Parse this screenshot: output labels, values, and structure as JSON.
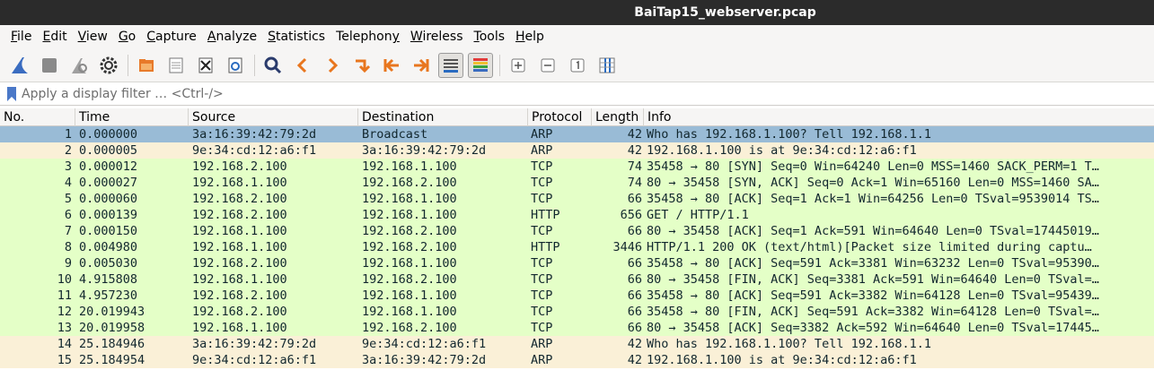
{
  "window": {
    "title": "BaiTap15_webserver.pcap"
  },
  "menu": [
    {
      "pre": "",
      "key": "F",
      "post": "ile"
    },
    {
      "pre": "",
      "key": "E",
      "post": "dit"
    },
    {
      "pre": "",
      "key": "V",
      "post": "iew"
    },
    {
      "pre": "",
      "key": "G",
      "post": "o"
    },
    {
      "pre": "",
      "key": "C",
      "post": "apture"
    },
    {
      "pre": "",
      "key": "A",
      "post": "nalyze"
    },
    {
      "pre": "",
      "key": "S",
      "post": "tatistics"
    },
    {
      "pre": "Telephon",
      "key": "y",
      "post": ""
    },
    {
      "pre": "",
      "key": "W",
      "post": "ireless"
    },
    {
      "pre": "",
      "key": "T",
      "post": "ools"
    },
    {
      "pre": "",
      "key": "H",
      "post": "elp"
    }
  ],
  "filter": {
    "placeholder": "Apply a display filter … <Ctrl-/>"
  },
  "columns": [
    "No.",
    "Time",
    "Source",
    "Destination",
    "Protocol",
    "Length",
    "Info"
  ],
  "colors": {
    "arp": "#faf0d7",
    "tcp": "#e7e6ff",
    "http": "#e4ffc7",
    "selected": "#99bbd6"
  },
  "packets": [
    {
      "no": "1",
      "time": "0.000000",
      "src": "3a:16:39:42:79:2d",
      "dst": "Broadcast",
      "proto": "ARP",
      "len": "42",
      "info": "Who has 192.168.1.100? Tell 192.168.1.1",
      "color": "selected"
    },
    {
      "no": "2",
      "time": "0.000005",
      "src": "9e:34:cd:12:a6:f1",
      "dst": "3a:16:39:42:79:2d",
      "proto": "ARP",
      "len": "42",
      "info": "192.168.1.100 is at 9e:34:cd:12:a6:f1",
      "color": "arp"
    },
    {
      "no": "3",
      "time": "0.000012",
      "src": "192.168.2.100",
      "dst": "192.168.1.100",
      "proto": "TCP",
      "len": "74",
      "info": "35458 → 80 [SYN] Seq=0 Win=64240 Len=0 MSS=1460 SACK_PERM=1 T…",
      "color": "http"
    },
    {
      "no": "4",
      "time": "0.000027",
      "src": "192.168.1.100",
      "dst": "192.168.2.100",
      "proto": "TCP",
      "len": "74",
      "info": "80 → 35458 [SYN, ACK] Seq=0 Ack=1 Win=65160 Len=0 MSS=1460 SA…",
      "color": "http"
    },
    {
      "no": "5",
      "time": "0.000060",
      "src": "192.168.2.100",
      "dst": "192.168.1.100",
      "proto": "TCP",
      "len": "66",
      "info": "35458 → 80 [ACK] Seq=1 Ack=1 Win=64256 Len=0 TSval=9539014 TS…",
      "color": "http"
    },
    {
      "no": "6",
      "time": "0.000139",
      "src": "192.168.2.100",
      "dst": "192.168.1.100",
      "proto": "HTTP",
      "len": "656",
      "info": "GET / HTTP/1.1",
      "color": "http"
    },
    {
      "no": "7",
      "time": "0.000150",
      "src": "192.168.1.100",
      "dst": "192.168.2.100",
      "proto": "TCP",
      "len": "66",
      "info": "80 → 35458 [ACK] Seq=1 Ack=591 Win=64640 Len=0 TSval=17445019…",
      "color": "http"
    },
    {
      "no": "8",
      "time": "0.004980",
      "src": "192.168.1.100",
      "dst": "192.168.2.100",
      "proto": "HTTP",
      "len": "3446",
      "info": "HTTP/1.1 200 OK  (text/html)[Packet size limited during captu…",
      "color": "http"
    },
    {
      "no": "9",
      "time": "0.005030",
      "src": "192.168.2.100",
      "dst": "192.168.1.100",
      "proto": "TCP",
      "len": "66",
      "info": "35458 → 80 [ACK] Seq=591 Ack=3381 Win=63232 Len=0 TSval=95390…",
      "color": "http"
    },
    {
      "no": "10",
      "time": "4.915808",
      "src": "192.168.1.100",
      "dst": "192.168.2.100",
      "proto": "TCP",
      "len": "66",
      "info": "80 → 35458 [FIN, ACK] Seq=3381 Ack=591 Win=64640 Len=0 TSval=…",
      "color": "http"
    },
    {
      "no": "11",
      "time": "4.957230",
      "src": "192.168.2.100",
      "dst": "192.168.1.100",
      "proto": "TCP",
      "len": "66",
      "info": "35458 → 80 [ACK] Seq=591 Ack=3382 Win=64128 Len=0 TSval=95439…",
      "color": "http"
    },
    {
      "no": "12",
      "time": "20.019943",
      "src": "192.168.2.100",
      "dst": "192.168.1.100",
      "proto": "TCP",
      "len": "66",
      "info": "35458 → 80 [FIN, ACK] Seq=591 Ack=3382 Win=64128 Len=0 TSval=…",
      "color": "http"
    },
    {
      "no": "13",
      "time": "20.019958",
      "src": "192.168.1.100",
      "dst": "192.168.2.100",
      "proto": "TCP",
      "len": "66",
      "info": "80 → 35458 [ACK] Seq=3382 Ack=592 Win=64640 Len=0 TSval=17445…",
      "color": "http"
    },
    {
      "no": "14",
      "time": "25.184946",
      "src": "3a:16:39:42:79:2d",
      "dst": "9e:34:cd:12:a6:f1",
      "proto": "ARP",
      "len": "42",
      "info": "Who has 192.168.1.100? Tell 192.168.1.1",
      "color": "arp"
    },
    {
      "no": "15",
      "time": "25.184954",
      "src": "9e:34:cd:12:a6:f1",
      "dst": "3a:16:39:42:79:2d",
      "proto": "ARP",
      "len": "42",
      "info": "192.168.1.100 is at 9e:34:cd:12:a6:f1",
      "color": "arp"
    }
  ],
  "toolbar": {
    "icons": [
      "shark-fin-start-icon",
      "stop-capture-icon",
      "restart-capture-icon",
      "capture-options-icon",
      "open-file-icon",
      "save-file-icon",
      "close-file-icon",
      "reload-file-icon",
      "find-packet-icon",
      "go-back-icon",
      "go-forward-icon",
      "go-to-packet-icon",
      "go-first-icon",
      "go-last-icon",
      "auto-scroll-icon",
      "colorize-icon",
      "zoom-in-icon",
      "zoom-out-icon",
      "normal-size-icon",
      "resize-columns-icon"
    ]
  }
}
